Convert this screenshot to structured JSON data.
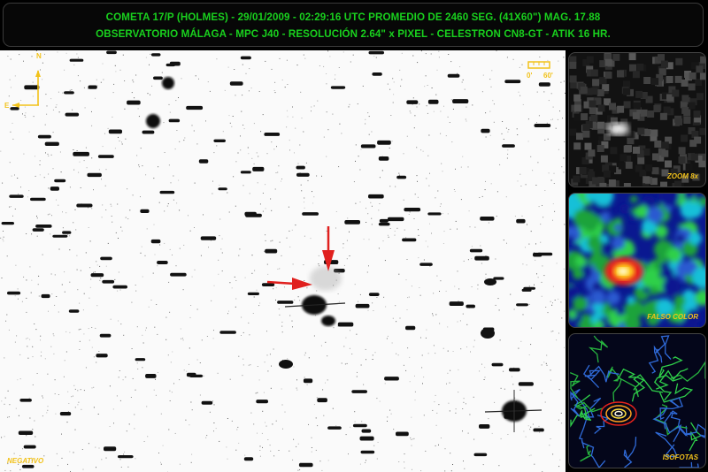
{
  "header": {
    "line1": "COMETA 17/P (HOLMES) - 29/01/2009 - 02:29:16 UTC PROMEDIO DE 2460 SEG. (41X60\") MAG. 17.88",
    "line2": "OBSERVATORIO MÁLAGA  - MPC J40 - RESOLUCIÓN 2.64\" x PIXEL - CELESTRON CN8-GT - ATIK 16 HR."
  },
  "compass": {
    "north": "N",
    "east": "E"
  },
  "scale_bar": {
    "start": "0'",
    "end": "60'"
  },
  "labels": {
    "main": "NEGATIVO",
    "zoom": "ZOOM 8x",
    "false_color": "FALSO COLOR",
    "isophotes": "ISOFOTAS"
  },
  "colors": {
    "header_text": "#19d11e",
    "label_text": "#f2c21a",
    "arrow": "#e0201e"
  }
}
